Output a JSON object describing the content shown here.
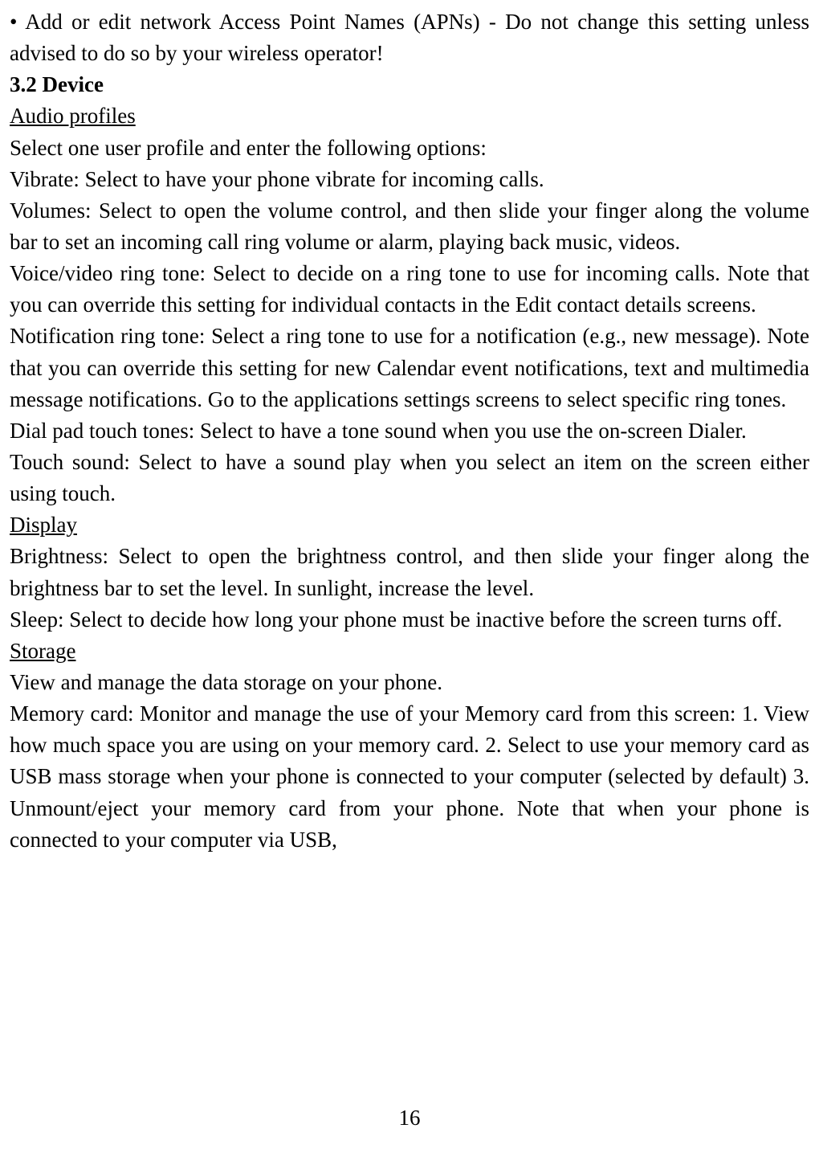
{
  "body": {
    "apn_note": "• Add or edit network Access Point Names (APNs) - Do not change this setting unless advised to do so by your wireless operator!",
    "section_heading": "3.2 Device",
    "audio_profiles_heading": "Audio profiles",
    "audio_profiles_intro": "Select one user profile and enter the following options:",
    "vibrate": "Vibrate: Select to have your phone vibrate for incoming calls.",
    "volumes": "Volumes: Select to open the volume control, and then slide your finger along the volume bar to set an incoming call ring volume or alarm, playing back music, videos.",
    "voice_video_ringtone": "Voice/video ring tone: Select to decide on a ring tone to use for incoming calls. Note that you can override this setting for individual contacts in the Edit contact details screens.",
    "notification_ringtone": "Notification ring tone: Select a ring tone to use for a notification (e.g., new message). Note that you can override this setting for new Calendar event notifications, text and multimedia message notifications. Go to the applications settings screens to select specific ring tones.",
    "dial_pad_tones": "Dial pad touch tones: Select to have a tone sound when you use the on-screen Dialer.",
    "touch_sound": "Touch sound: Select to have a sound play when you select an item on the screen either using touch.",
    "display_heading": "Display ",
    "brightness": "Brightness: Select to open the brightness control, and then slide your finger along the brightness bar to set the level. In sunlight, increase the level.",
    "sleep": "Sleep: Select to decide how long your phone must be inactive before the screen turns off.",
    "storage_heading": "Storage",
    "storage_intro": "View and manage the data storage on your phone.",
    "memory_card": "Memory card: Monitor and manage the use of your Memory card from this screen: 1. View how much space you are using on your memory card. 2. Select to use your memory card as USB mass storage when your phone is connected to your computer (selected by default) 3. Unmount/eject your memory card from your phone. Note that when your phone is connected to your computer via USB,"
  },
  "page_number": "16"
}
